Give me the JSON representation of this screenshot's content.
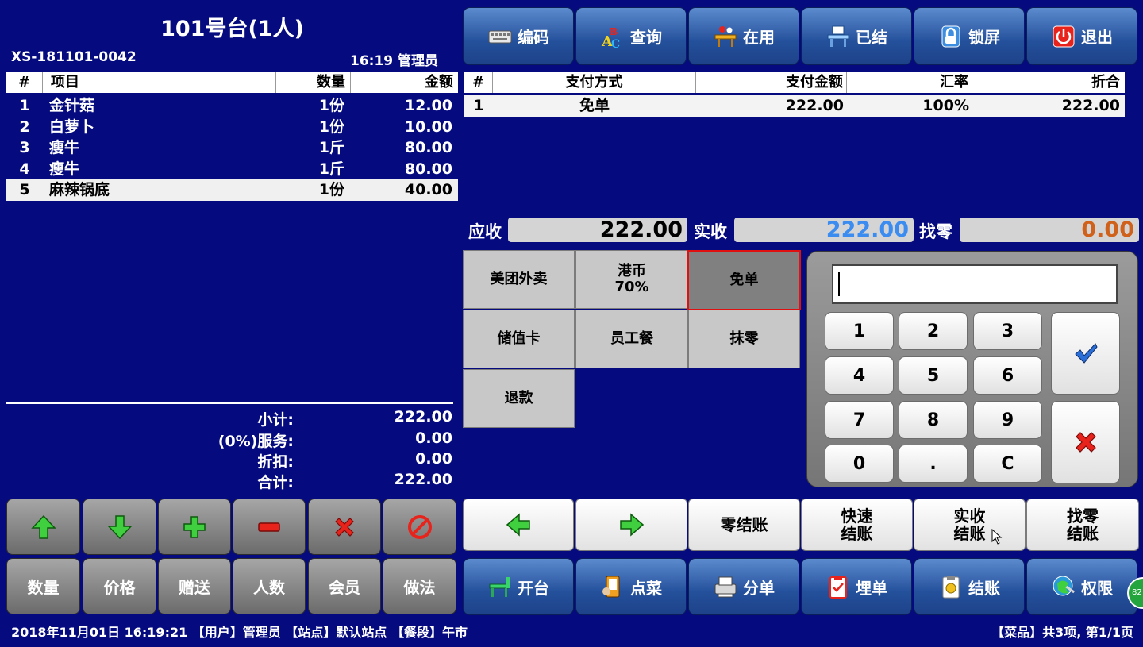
{
  "order": {
    "table_title": "101号台(1人)",
    "order_no": "XS-181101-0042",
    "time_user": "16:19 管理员",
    "headers": {
      "num": "#",
      "item": "项目",
      "qty": "数量",
      "amount": "金额"
    },
    "items": [
      {
        "num": "1",
        "name": "金针菇",
        "qty": "1份",
        "amount": "12.00"
      },
      {
        "num": "2",
        "name": "白萝卜",
        "qty": "1份",
        "amount": "10.00"
      },
      {
        "num": "3",
        "name": "瘦牛",
        "qty": "1斤",
        "amount": "80.00"
      },
      {
        "num": "4",
        "name": "瘦牛",
        "qty": "1斤",
        "amount": "80.00"
      },
      {
        "num": "5",
        "name": "麻辣锅底",
        "qty": "1份",
        "amount": "40.00"
      }
    ],
    "summary": {
      "subtotal_label": "小计:",
      "subtotal": "222.00",
      "service_label": "(0%)服务:",
      "service": "0.00",
      "discount_label": "折扣:",
      "discount": "0.00",
      "total_label": "合计:",
      "total": "222.00"
    }
  },
  "left_tools": {
    "row1_icons": [
      "up-arrow-icon",
      "down-arrow-icon",
      "plus-icon",
      "minus-icon",
      "delete-x-icon",
      "forbid-icon"
    ],
    "row2": [
      "数量",
      "价格",
      "赠送",
      "人数",
      "会员",
      "做法"
    ]
  },
  "top_toolbar": [
    {
      "label": "编码",
      "icon": "keyboard-icon"
    },
    {
      "label": "查询",
      "icon": "abc-query-icon"
    },
    {
      "label": "在用",
      "icon": "table-in-use-icon"
    },
    {
      "label": "已结",
      "icon": "table-settled-icon"
    },
    {
      "label": "锁屏",
      "icon": "lock-icon"
    },
    {
      "label": "退出",
      "icon": "power-icon"
    }
  ],
  "payment": {
    "headers": {
      "num": "#",
      "method": "支付方式",
      "amount": "支付金额",
      "rate": "汇率",
      "discount": "折合"
    },
    "rows": [
      {
        "num": "1",
        "method": "免单",
        "amount": "222.00",
        "rate": "100%",
        "discount": "222.00"
      }
    ]
  },
  "amounts": {
    "receivable_label": "应收",
    "receivable": "222.00",
    "received_label": "实收",
    "received": "222.00",
    "change_label": "找零",
    "change": "0.00",
    "received_color": "#3a8cf0",
    "change_color": "#d0611a"
  },
  "methods": [
    {
      "label": "美团外卖",
      "label2": ""
    },
    {
      "label": "港币",
      "label2": "70%"
    },
    {
      "label": "免单",
      "label2": "",
      "selected": true
    },
    {
      "label": "储值卡",
      "label2": ""
    },
    {
      "label": "员工餐",
      "label2": ""
    },
    {
      "label": "抹零",
      "label2": ""
    },
    {
      "label": "退款",
      "label2": ""
    }
  ],
  "keypad": {
    "input_value": "",
    "keys": [
      "1",
      "2",
      "3",
      "4",
      "5",
      "6",
      "7",
      "8",
      "9",
      "0",
      ".",
      "C"
    ],
    "confirm_icon": "checkmark-icon",
    "cancel_icon": "cancel-x-icon"
  },
  "settle_bar": [
    {
      "label": "",
      "icon": "left-arrow-icon"
    },
    {
      "label": "",
      "icon": "right-arrow-icon"
    },
    {
      "label": "零结账"
    },
    {
      "label": "快速\n结账"
    },
    {
      "label": "实收\n结账"
    },
    {
      "label": "找零\n结账"
    }
  ],
  "bottom_toolbar": [
    {
      "label": "开台",
      "icon": "open-table-icon"
    },
    {
      "label": "点菜",
      "icon": "order-dish-icon"
    },
    {
      "label": "分单",
      "icon": "split-bill-icon"
    },
    {
      "label": "埋单",
      "icon": "bill-clipboard-icon"
    },
    {
      "label": "结账",
      "icon": "checkout-icon"
    },
    {
      "label": "权限",
      "icon": "permission-icon"
    }
  ],
  "corner_badge": "82",
  "status": {
    "left": "2018年11月01日 16:19:21 【用户】管理员 【站点】默认站点 【餐段】午市",
    "right": "【菜品】共3项, 第1/1页"
  }
}
